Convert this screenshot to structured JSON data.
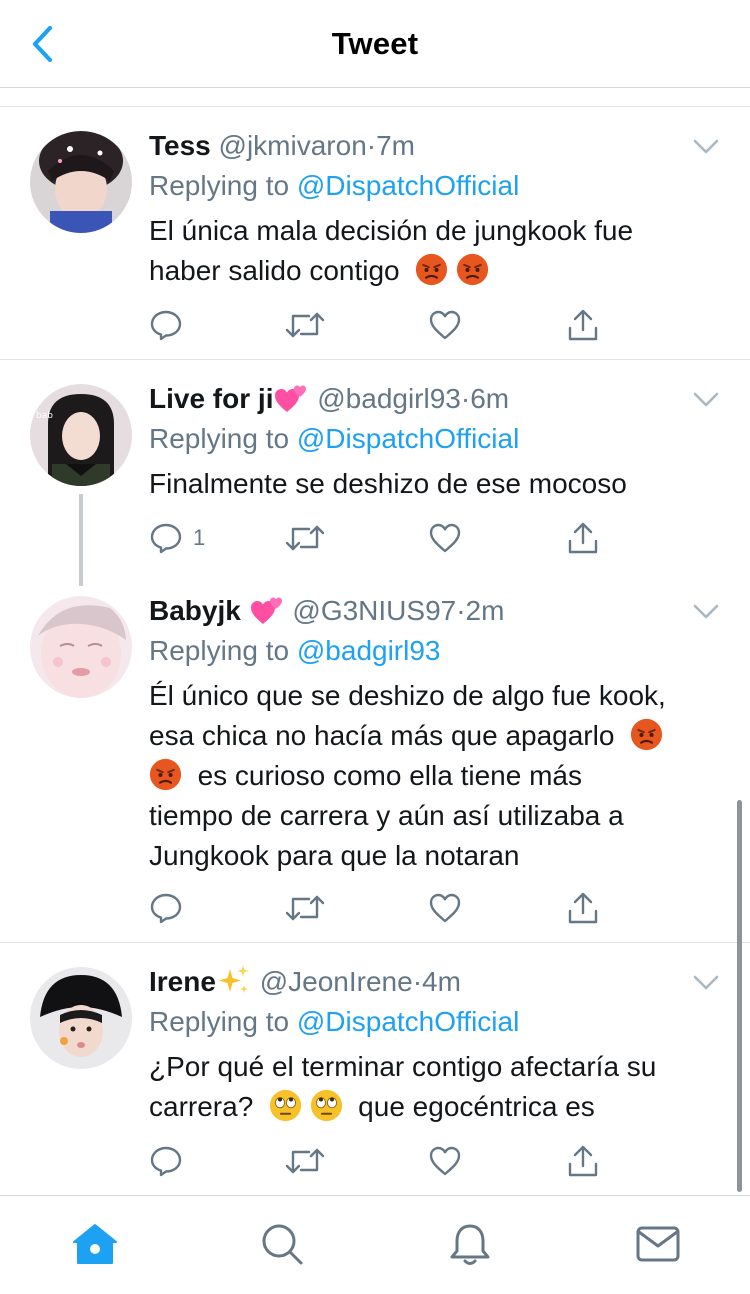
{
  "header": {
    "title": "Tweet",
    "back_icon": "chevron-left-icon"
  },
  "tweets": [
    {
      "name": "Tess",
      "handle": "@jkmivaron",
      "dot": "·",
      "time": "7m",
      "replying_prefix": "Replying to ",
      "replying_mention": "@DispatchOfficial",
      "text_lines": [
        "El única mala decisión de jungkook fue",
        "haber salido contigo"
      ],
      "reply_count": ""
    },
    {
      "name": "Live for ji",
      "handle": "@badgirl93",
      "dot": "·",
      "time": "6m",
      "replying_prefix": "Replying to ",
      "replying_mention": "@DispatchOfficial",
      "text_lines": [
        "Finalmente se deshizo de ese mocoso"
      ],
      "reply_count": "1"
    },
    {
      "name": "Babyjk",
      "handle": "@G3NIUS97",
      "dot": "·",
      "time": "2m",
      "replying_prefix": "Replying to ",
      "replying_mention": "@badgirl93",
      "text_lines": [
        "Él único que se deshizo de algo fue kook,",
        "esa chica no hacía más que apagarlo",
        "es curioso como ella tiene más",
        "tiempo de carrera y aún así utilizaba a",
        "Jungkook para que la notaran"
      ],
      "reply_count": ""
    },
    {
      "name": "Irene",
      "handle": "@JeonIrene",
      "dot": "·",
      "time": "4m",
      "replying_prefix": "Replying to ",
      "replying_mention": "@DispatchOfficial",
      "text_lines": [
        "¿Por qué el terminar contigo afectaría su",
        "carrera?",
        "que egocéntrica es"
      ],
      "reply_count": ""
    }
  ],
  "emojis": {
    "angry": "angry-face-emoji",
    "eyeroll": "eye-roll-emoji",
    "hearts": "two-hearts-emoji",
    "sparkles": "sparkles-emoji"
  },
  "colors": {
    "accent": "#1da1f2",
    "text": "#14171a",
    "secondary": "#657786",
    "angry": "#e8561f",
    "eyeroll": "#f7c12a"
  },
  "tabbar": {
    "items": [
      "home-icon",
      "search-icon",
      "notifications-icon",
      "messages-icon"
    ],
    "active": "home-icon"
  }
}
